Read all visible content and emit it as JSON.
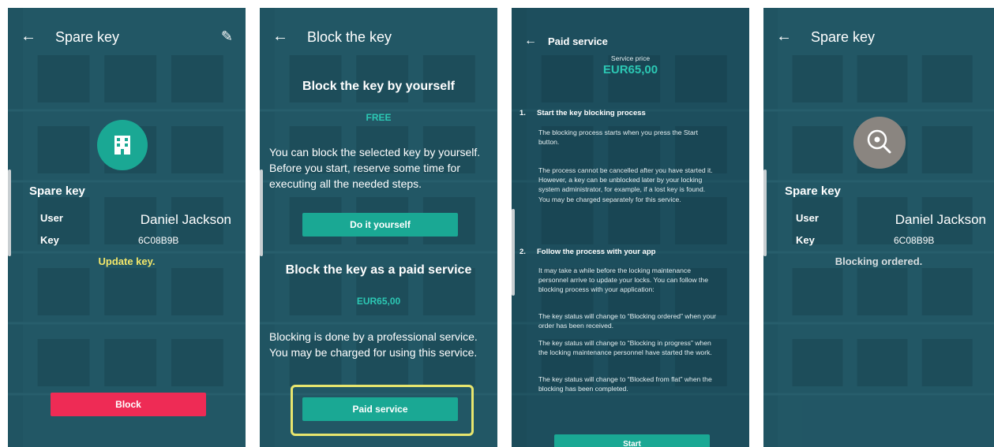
{
  "colors": {
    "teal": "#1aa894",
    "accent_teal": "#2cc8b4",
    "yellow": "#f2e66a",
    "red_button": "#ee2b55",
    "grey_circle": "#8a8580",
    "highlight_border": "#e8e66e"
  },
  "screen1": {
    "back_icon": "arrow-left-icon",
    "title": "Spare key",
    "edit_icon": "pencil-icon",
    "key_icon": "building-icon",
    "section_title": "Spare key",
    "user_label": "User",
    "user_value": "Daniel Jackson",
    "key_label": "Key",
    "key_value": "6C08B9B",
    "status": "Update key.",
    "block_button": "Block"
  },
  "screen2": {
    "back_icon": "arrow-left-icon",
    "title": "Block the key",
    "self_heading": "Block the key by yourself",
    "self_price": "FREE",
    "self_text": "You can block the selected key by yourself. Before you start, reserve some time for executing all the needed steps.",
    "self_button": "Do it yourself",
    "paid_heading": "Block the key as a paid service",
    "paid_price": "EUR65,00",
    "paid_text": "Blocking is done by a professional service. You may be charged for using this service.",
    "paid_button": "Paid service"
  },
  "screen3": {
    "back_icon": "arrow-left-icon",
    "title": "Paid service",
    "price_label": "Service price",
    "price_value": "EUR65,00",
    "step1_num": "1.",
    "step1_title": "Start the key blocking process",
    "step1_p1": "The blocking process starts when you press the Start button.",
    "step1_p2": "The process cannot be cancelled after you have started it. However, a key can be unblocked later by your locking system administrator, for example, if a lost key is found. You may be charged separately for this service.",
    "step2_num": "2.",
    "step2_title": "Follow the process with your app",
    "step2_p1": "It may take a while before the locking maintenance personnel arrive to update your locks. You can follow the blocking process with your application:",
    "step2_p2": "The key status will change to “Blocking ordered” when your order has been received.",
    "step2_p3": "The key status will change to “Blocking in progress” when the locking maintenance personnel have started the work.",
    "step2_p4": "The key status will change to “Blocked from flat” when the blocking has been completed.",
    "start_button": "Start"
  },
  "screen4": {
    "back_icon": "arrow-left-icon",
    "title": "Spare key",
    "key_icon": "key-search-icon",
    "section_title": "Spare key",
    "user_label": "User",
    "user_value": "Daniel Jackson",
    "key_label": "Key",
    "key_value": "6C08B9B",
    "status": "Blocking ordered."
  }
}
